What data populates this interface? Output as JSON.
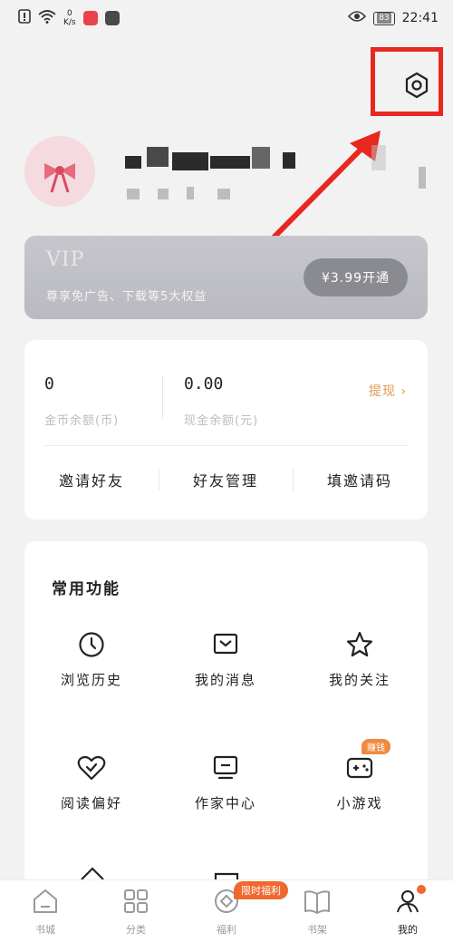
{
  "status_bar": {
    "speed_value": "0",
    "speed_unit": "K/s",
    "battery": "83",
    "time": "22:41"
  },
  "settings": {
    "icon": "settings-hexagon-icon"
  },
  "vip": {
    "title": "VIP",
    "description": "尊享免广告、下载等5大权益",
    "button": "¥3.99开通"
  },
  "wallet": {
    "coins_value": "0",
    "coins_label": "金币余额(币)",
    "cash_value": "0.00",
    "cash_label": "现金余额(元)",
    "withdraw": "提现 ›",
    "actions": [
      "邀请好友",
      "好友管理",
      "填邀请码"
    ]
  },
  "functions": {
    "title": "常用功能",
    "items": [
      {
        "label": "浏览历史",
        "icon": "clock-icon"
      },
      {
        "label": "我的消息",
        "icon": "message-box-icon"
      },
      {
        "label": "我的关注",
        "icon": "star-icon"
      },
      {
        "label": "阅读偏好",
        "icon": "heart-check-icon"
      },
      {
        "label": "作家中心",
        "icon": "monitor-icon"
      },
      {
        "label": "小游戏",
        "icon": "gamepad-icon",
        "badge": "赚钱"
      }
    ]
  },
  "bottom_nav": {
    "items": [
      {
        "label": "书城",
        "icon": "home-icon"
      },
      {
        "label": "分类",
        "icon": "grid-icon"
      },
      {
        "label": "福利",
        "icon": "coin-icon"
      },
      {
        "label": "书架",
        "icon": "book-icon"
      },
      {
        "label": "我的",
        "icon": "user-icon"
      }
    ],
    "promo_badge": "限时福利"
  },
  "colors": {
    "highlight": "#e8281e",
    "accent_orange": "#f0682e",
    "withdraw": "#e09a52"
  }
}
